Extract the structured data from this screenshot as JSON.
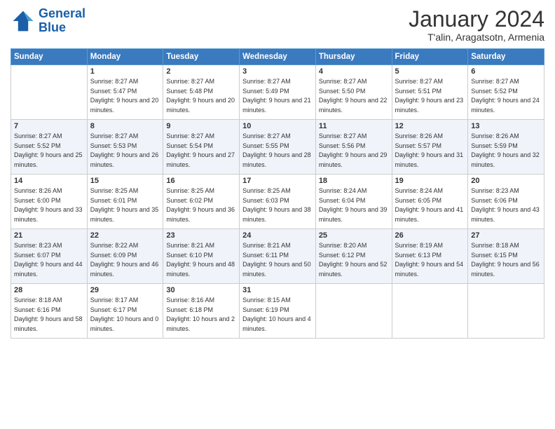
{
  "logo": {
    "line1": "General",
    "line2": "Blue"
  },
  "header": {
    "month": "January 2024",
    "location": "T'alin, Aragatsotn, Armenia"
  },
  "weekdays": [
    "Sunday",
    "Monday",
    "Tuesday",
    "Wednesday",
    "Thursday",
    "Friday",
    "Saturday"
  ],
  "weeks": [
    [
      {
        "day": "",
        "sunrise": "",
        "sunset": "",
        "daylight": ""
      },
      {
        "day": "1",
        "sunrise": "Sunrise: 8:27 AM",
        "sunset": "Sunset: 5:47 PM",
        "daylight": "Daylight: 9 hours and 20 minutes."
      },
      {
        "day": "2",
        "sunrise": "Sunrise: 8:27 AM",
        "sunset": "Sunset: 5:48 PM",
        "daylight": "Daylight: 9 hours and 20 minutes."
      },
      {
        "day": "3",
        "sunrise": "Sunrise: 8:27 AM",
        "sunset": "Sunset: 5:49 PM",
        "daylight": "Daylight: 9 hours and 21 minutes."
      },
      {
        "day": "4",
        "sunrise": "Sunrise: 8:27 AM",
        "sunset": "Sunset: 5:50 PM",
        "daylight": "Daylight: 9 hours and 22 minutes."
      },
      {
        "day": "5",
        "sunrise": "Sunrise: 8:27 AM",
        "sunset": "Sunset: 5:51 PM",
        "daylight": "Daylight: 9 hours and 23 minutes."
      },
      {
        "day": "6",
        "sunrise": "Sunrise: 8:27 AM",
        "sunset": "Sunset: 5:52 PM",
        "daylight": "Daylight: 9 hours and 24 minutes."
      }
    ],
    [
      {
        "day": "7",
        "sunrise": "Sunrise: 8:27 AM",
        "sunset": "Sunset: 5:52 PM",
        "daylight": "Daylight: 9 hours and 25 minutes."
      },
      {
        "day": "8",
        "sunrise": "Sunrise: 8:27 AM",
        "sunset": "Sunset: 5:53 PM",
        "daylight": "Daylight: 9 hours and 26 minutes."
      },
      {
        "day": "9",
        "sunrise": "Sunrise: 8:27 AM",
        "sunset": "Sunset: 5:54 PM",
        "daylight": "Daylight: 9 hours and 27 minutes."
      },
      {
        "day": "10",
        "sunrise": "Sunrise: 8:27 AM",
        "sunset": "Sunset: 5:55 PM",
        "daylight": "Daylight: 9 hours and 28 minutes."
      },
      {
        "day": "11",
        "sunrise": "Sunrise: 8:27 AM",
        "sunset": "Sunset: 5:56 PM",
        "daylight": "Daylight: 9 hours and 29 minutes."
      },
      {
        "day": "12",
        "sunrise": "Sunrise: 8:26 AM",
        "sunset": "Sunset: 5:57 PM",
        "daylight": "Daylight: 9 hours and 31 minutes."
      },
      {
        "day": "13",
        "sunrise": "Sunrise: 8:26 AM",
        "sunset": "Sunset: 5:59 PM",
        "daylight": "Daylight: 9 hours and 32 minutes."
      }
    ],
    [
      {
        "day": "14",
        "sunrise": "Sunrise: 8:26 AM",
        "sunset": "Sunset: 6:00 PM",
        "daylight": "Daylight: 9 hours and 33 minutes."
      },
      {
        "day": "15",
        "sunrise": "Sunrise: 8:25 AM",
        "sunset": "Sunset: 6:01 PM",
        "daylight": "Daylight: 9 hours and 35 minutes."
      },
      {
        "day": "16",
        "sunrise": "Sunrise: 8:25 AM",
        "sunset": "Sunset: 6:02 PM",
        "daylight": "Daylight: 9 hours and 36 minutes."
      },
      {
        "day": "17",
        "sunrise": "Sunrise: 8:25 AM",
        "sunset": "Sunset: 6:03 PM",
        "daylight": "Daylight: 9 hours and 38 minutes."
      },
      {
        "day": "18",
        "sunrise": "Sunrise: 8:24 AM",
        "sunset": "Sunset: 6:04 PM",
        "daylight": "Daylight: 9 hours and 39 minutes."
      },
      {
        "day": "19",
        "sunrise": "Sunrise: 8:24 AM",
        "sunset": "Sunset: 6:05 PM",
        "daylight": "Daylight: 9 hours and 41 minutes."
      },
      {
        "day": "20",
        "sunrise": "Sunrise: 8:23 AM",
        "sunset": "Sunset: 6:06 PM",
        "daylight": "Daylight: 9 hours and 43 minutes."
      }
    ],
    [
      {
        "day": "21",
        "sunrise": "Sunrise: 8:23 AM",
        "sunset": "Sunset: 6:07 PM",
        "daylight": "Daylight: 9 hours and 44 minutes."
      },
      {
        "day": "22",
        "sunrise": "Sunrise: 8:22 AM",
        "sunset": "Sunset: 6:09 PM",
        "daylight": "Daylight: 9 hours and 46 minutes."
      },
      {
        "day": "23",
        "sunrise": "Sunrise: 8:21 AM",
        "sunset": "Sunset: 6:10 PM",
        "daylight": "Daylight: 9 hours and 48 minutes."
      },
      {
        "day": "24",
        "sunrise": "Sunrise: 8:21 AM",
        "sunset": "Sunset: 6:11 PM",
        "daylight": "Daylight: 9 hours and 50 minutes."
      },
      {
        "day": "25",
        "sunrise": "Sunrise: 8:20 AM",
        "sunset": "Sunset: 6:12 PM",
        "daylight": "Daylight: 9 hours and 52 minutes."
      },
      {
        "day": "26",
        "sunrise": "Sunrise: 8:19 AM",
        "sunset": "Sunset: 6:13 PM",
        "daylight": "Daylight: 9 hours and 54 minutes."
      },
      {
        "day": "27",
        "sunrise": "Sunrise: 8:18 AM",
        "sunset": "Sunset: 6:15 PM",
        "daylight": "Daylight: 9 hours and 56 minutes."
      }
    ],
    [
      {
        "day": "28",
        "sunrise": "Sunrise: 8:18 AM",
        "sunset": "Sunset: 6:16 PM",
        "daylight": "Daylight: 9 hours and 58 minutes."
      },
      {
        "day": "29",
        "sunrise": "Sunrise: 8:17 AM",
        "sunset": "Sunset: 6:17 PM",
        "daylight": "Daylight: 10 hours and 0 minutes."
      },
      {
        "day": "30",
        "sunrise": "Sunrise: 8:16 AM",
        "sunset": "Sunset: 6:18 PM",
        "daylight": "Daylight: 10 hours and 2 minutes."
      },
      {
        "day": "31",
        "sunrise": "Sunrise: 8:15 AM",
        "sunset": "Sunset: 6:19 PM",
        "daylight": "Daylight: 10 hours and 4 minutes."
      },
      {
        "day": "",
        "sunrise": "",
        "sunset": "",
        "daylight": ""
      },
      {
        "day": "",
        "sunrise": "",
        "sunset": "",
        "daylight": ""
      },
      {
        "day": "",
        "sunrise": "",
        "sunset": "",
        "daylight": ""
      }
    ]
  ]
}
